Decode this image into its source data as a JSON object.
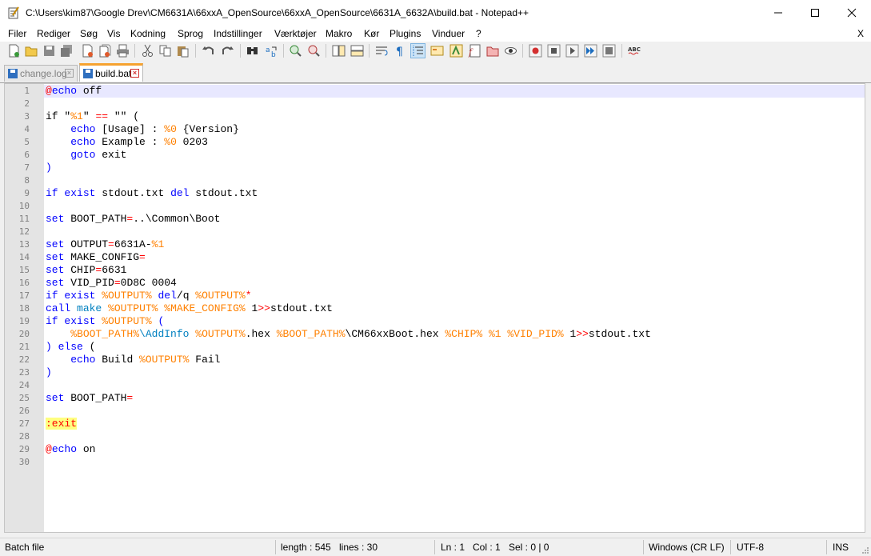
{
  "window": {
    "title": "C:\\Users\\kim87\\Google Drev\\CM6631A\\66xxA_OpenSource\\66xxA_OpenSource\\6631A_6632A\\build.bat - Notepad++",
    "app_icon": "notepad-icon"
  },
  "menu": {
    "items": [
      "Filer",
      "Rediger",
      "Søg",
      "Vis",
      "Kodning",
      "Sprog",
      "Indstillinger",
      "Værktøjer",
      "Makro",
      "Kør",
      "Plugins",
      "Vinduer",
      "?"
    ],
    "close_label": "X"
  },
  "toolbar": {
    "icons": [
      "new-file-icon",
      "open-file-icon",
      "save-icon",
      "save-all-icon",
      "close-icon",
      "close-all-icon",
      "print-icon",
      "cut-icon",
      "copy-icon",
      "paste-icon",
      "undo-icon",
      "redo-icon",
      "find-icon",
      "replace-icon",
      "zoom-in-icon",
      "zoom-out-icon",
      "sync-vertical-icon",
      "sync-horizontal-icon",
      "word-wrap-icon",
      "show-all-chars-icon",
      "indent-guide-icon",
      "user-language-icon",
      "document-map-icon",
      "function-list-icon",
      "folder-workspace-icon",
      "monitoring-icon",
      "record-macro-icon",
      "stop-macro-icon",
      "play-macro-icon",
      "run-macro-multiple-icon",
      "save-macro-icon",
      "spell-check-icon"
    ],
    "selected": "indent-guide-icon"
  },
  "tabs": [
    {
      "label": "change.log",
      "active": false,
      "icon": "saved-file-icon"
    },
    {
      "label": "build.bat",
      "active": true,
      "icon": "saved-file-icon"
    }
  ],
  "editor": {
    "current_line": 1,
    "lines": [
      [
        [
          "@",
          "op"
        ],
        [
          "echo",
          "kw"
        ],
        [
          " off",
          ""
        ]
      ],
      [],
      [
        [
          "if",
          ""
        ],
        [
          " \"",
          ""
        ],
        [
          "%1",
          "var"
        ],
        [
          "\" ",
          ""
        ],
        [
          "==",
          "op"
        ],
        [
          " \"\" (",
          ""
        ]
      ],
      [
        [
          "    ",
          ""
        ],
        [
          "echo",
          "kw"
        ],
        [
          " [Usage] : ",
          ""
        ],
        [
          "%0",
          "var"
        ],
        [
          " {Version}",
          ""
        ]
      ],
      [
        [
          "    ",
          ""
        ],
        [
          "echo",
          "kw"
        ],
        [
          " Example : ",
          ""
        ],
        [
          "%0",
          "var"
        ],
        [
          " 0203",
          ""
        ]
      ],
      [
        [
          "    ",
          ""
        ],
        [
          "goto",
          "kw"
        ],
        [
          " exit",
          ""
        ]
      ],
      [
        [
          ")",
          "kw"
        ]
      ],
      [],
      [
        [
          "if",
          "kw"
        ],
        [
          " ",
          ""
        ],
        [
          "exist",
          "kw"
        ],
        [
          " stdout.txt ",
          ""
        ],
        [
          "del",
          "kw"
        ],
        [
          " stdout.txt",
          ""
        ]
      ],
      [],
      [
        [
          "set",
          "kw"
        ],
        [
          " BOOT_PATH",
          ""
        ],
        [
          "=",
          "op"
        ],
        [
          "..\\Common\\Boot",
          ""
        ]
      ],
      [],
      [
        [
          "set",
          "kw"
        ],
        [
          " OUTPUT",
          ""
        ],
        [
          "=",
          "op"
        ],
        [
          "6631A-",
          ""
        ],
        [
          "%1",
          "var"
        ]
      ],
      [
        [
          "set",
          "kw"
        ],
        [
          " MAKE_CONFIG",
          ""
        ],
        [
          "=",
          "op"
        ]
      ],
      [
        [
          "set",
          "kw"
        ],
        [
          " CHIP",
          ""
        ],
        [
          "=",
          "op"
        ],
        [
          "6631",
          ""
        ]
      ],
      [
        [
          "set",
          "kw"
        ],
        [
          " VID_PID",
          ""
        ],
        [
          "=",
          "op"
        ],
        [
          "0D8C 0004",
          ""
        ]
      ],
      [
        [
          "if",
          "kw"
        ],
        [
          " ",
          ""
        ],
        [
          "exist",
          "kw"
        ],
        [
          " ",
          ""
        ],
        [
          "%OUTPUT%",
          "var"
        ],
        [
          " ",
          ""
        ],
        [
          "del",
          "kw"
        ],
        [
          "/q ",
          ""
        ],
        [
          "%OUTPUT%",
          "var"
        ],
        [
          "*",
          "op"
        ]
      ],
      [
        [
          "call",
          "kw"
        ],
        [
          " ",
          ""
        ],
        [
          "make",
          "ext"
        ],
        [
          " ",
          ""
        ],
        [
          "%OUTPUT%",
          "var"
        ],
        [
          " ",
          ""
        ],
        [
          "%MAKE_CONFIG%",
          "var"
        ],
        [
          " 1",
          ""
        ],
        [
          ">>",
          "op"
        ],
        [
          "stdout.txt",
          ""
        ]
      ],
      [
        [
          "if",
          "kw"
        ],
        [
          " ",
          ""
        ],
        [
          "exist",
          "kw"
        ],
        [
          " ",
          ""
        ],
        [
          "%OUTPUT%",
          "var"
        ],
        [
          " (",
          "kw"
        ]
      ],
      [
        [
          "    ",
          ""
        ],
        [
          "%BOOT_PATH%",
          "var"
        ],
        [
          "\\AddInfo",
          "ext"
        ],
        [
          " ",
          ""
        ],
        [
          "%OUTPUT%",
          "var"
        ],
        [
          ".hex ",
          ""
        ],
        [
          "%BOOT_PATH%",
          "var"
        ],
        [
          "\\CM66xxBoot.hex ",
          ""
        ],
        [
          "%CHIP%",
          "var"
        ],
        [
          " ",
          ""
        ],
        [
          "%1",
          "var"
        ],
        [
          " ",
          ""
        ],
        [
          "%VID_PID%",
          "var"
        ],
        [
          " 1",
          ""
        ],
        [
          ">>",
          "op"
        ],
        [
          "stdout.txt",
          ""
        ]
      ],
      [
        [
          ") ",
          "kw"
        ],
        [
          "else",
          "kw"
        ],
        [
          " (",
          ""
        ]
      ],
      [
        [
          "    ",
          ""
        ],
        [
          "echo",
          "kw"
        ],
        [
          " Build ",
          ""
        ],
        [
          "%OUTPUT%",
          "var"
        ],
        [
          " Fail",
          ""
        ]
      ],
      [
        [
          ")",
          "kw"
        ]
      ],
      [],
      [
        [
          "set",
          "kw"
        ],
        [
          " BOOT_PATH",
          ""
        ],
        [
          "=",
          "op"
        ]
      ],
      [],
      [
        [
          ":exit",
          "lab"
        ]
      ],
      [],
      [
        [
          "@",
          "op"
        ],
        [
          "echo",
          "kw"
        ],
        [
          " on",
          ""
        ]
      ],
      []
    ]
  },
  "status": {
    "language": "Batch file",
    "length": "length : 545",
    "lines": "lines : 30",
    "ln": "Ln : 1",
    "col": "Col : 1",
    "sel": "Sel : 0 | 0",
    "eol": "Windows (CR LF)",
    "encoding": "UTF-8",
    "mode": "INS"
  }
}
